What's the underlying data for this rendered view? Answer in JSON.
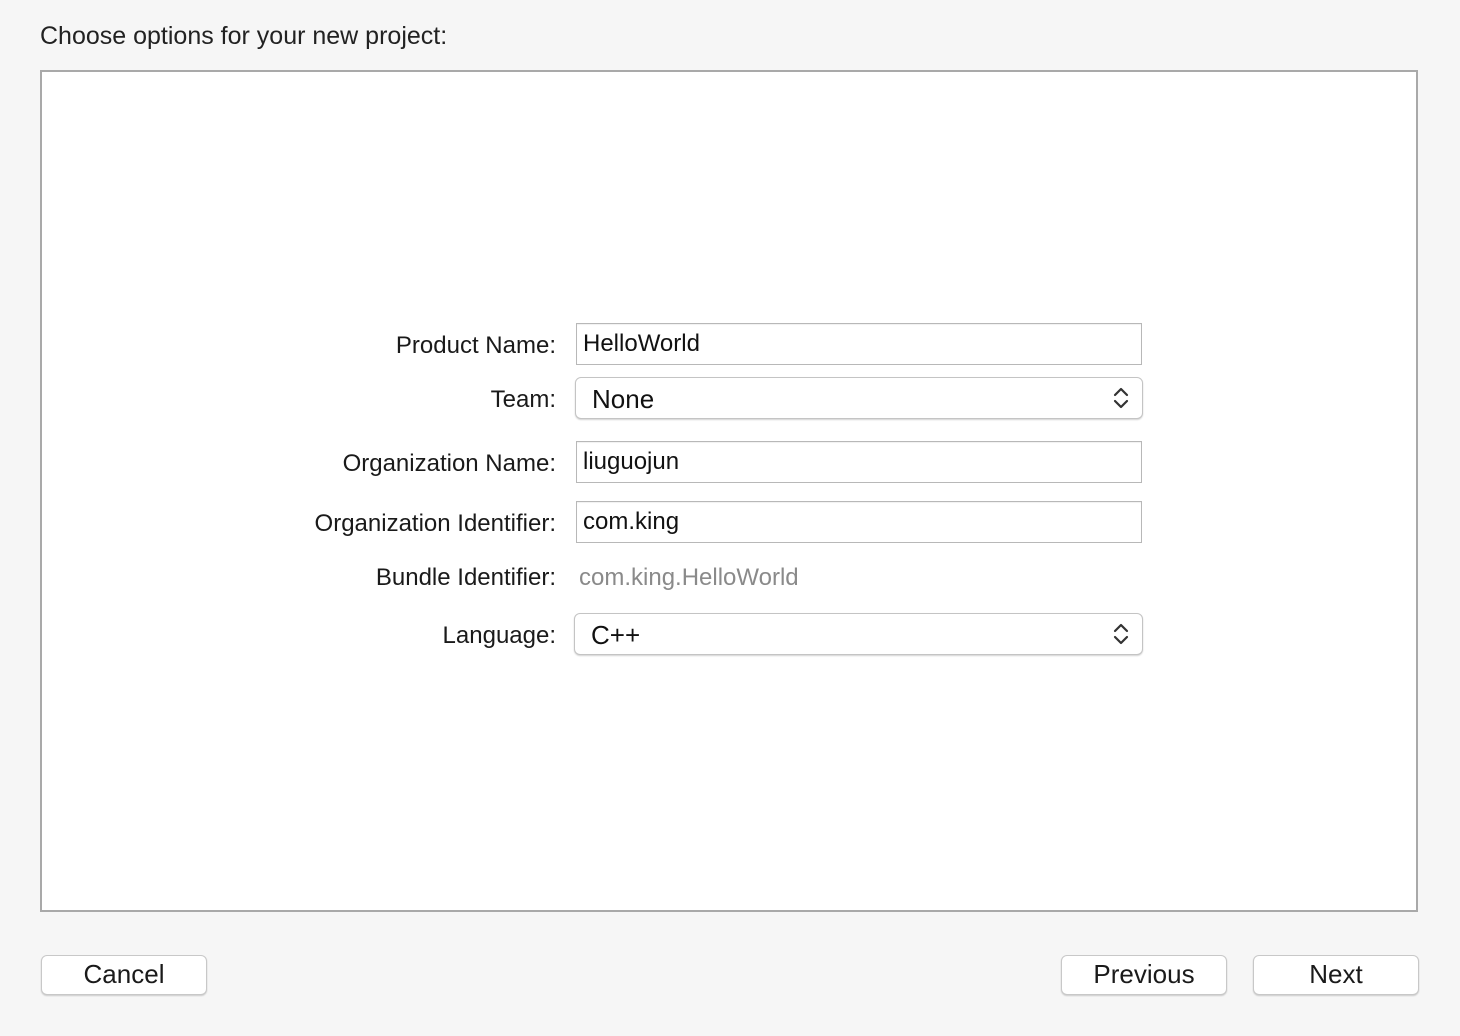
{
  "header": {
    "title": "Choose options for your new project:"
  },
  "form": {
    "product_name": {
      "label": "Product Name:",
      "value": "HelloWorld"
    },
    "team": {
      "label": "Team:",
      "selected": "None"
    },
    "organization_name": {
      "label": "Organization Name:",
      "value": "liuguojun"
    },
    "organization_identifier": {
      "label": "Organization Identifier:",
      "value": "com.king"
    },
    "bundle_identifier": {
      "label": "Bundle Identifier:",
      "value": "com.king.HelloWorld"
    },
    "language": {
      "label": "Language:",
      "selected": "C++"
    }
  },
  "footer": {
    "cancel_label": "Cancel",
    "previous_label": "Previous",
    "next_label": "Next"
  },
  "icons": {
    "popup_arrows": "up-down-chevron-icon"
  }
}
